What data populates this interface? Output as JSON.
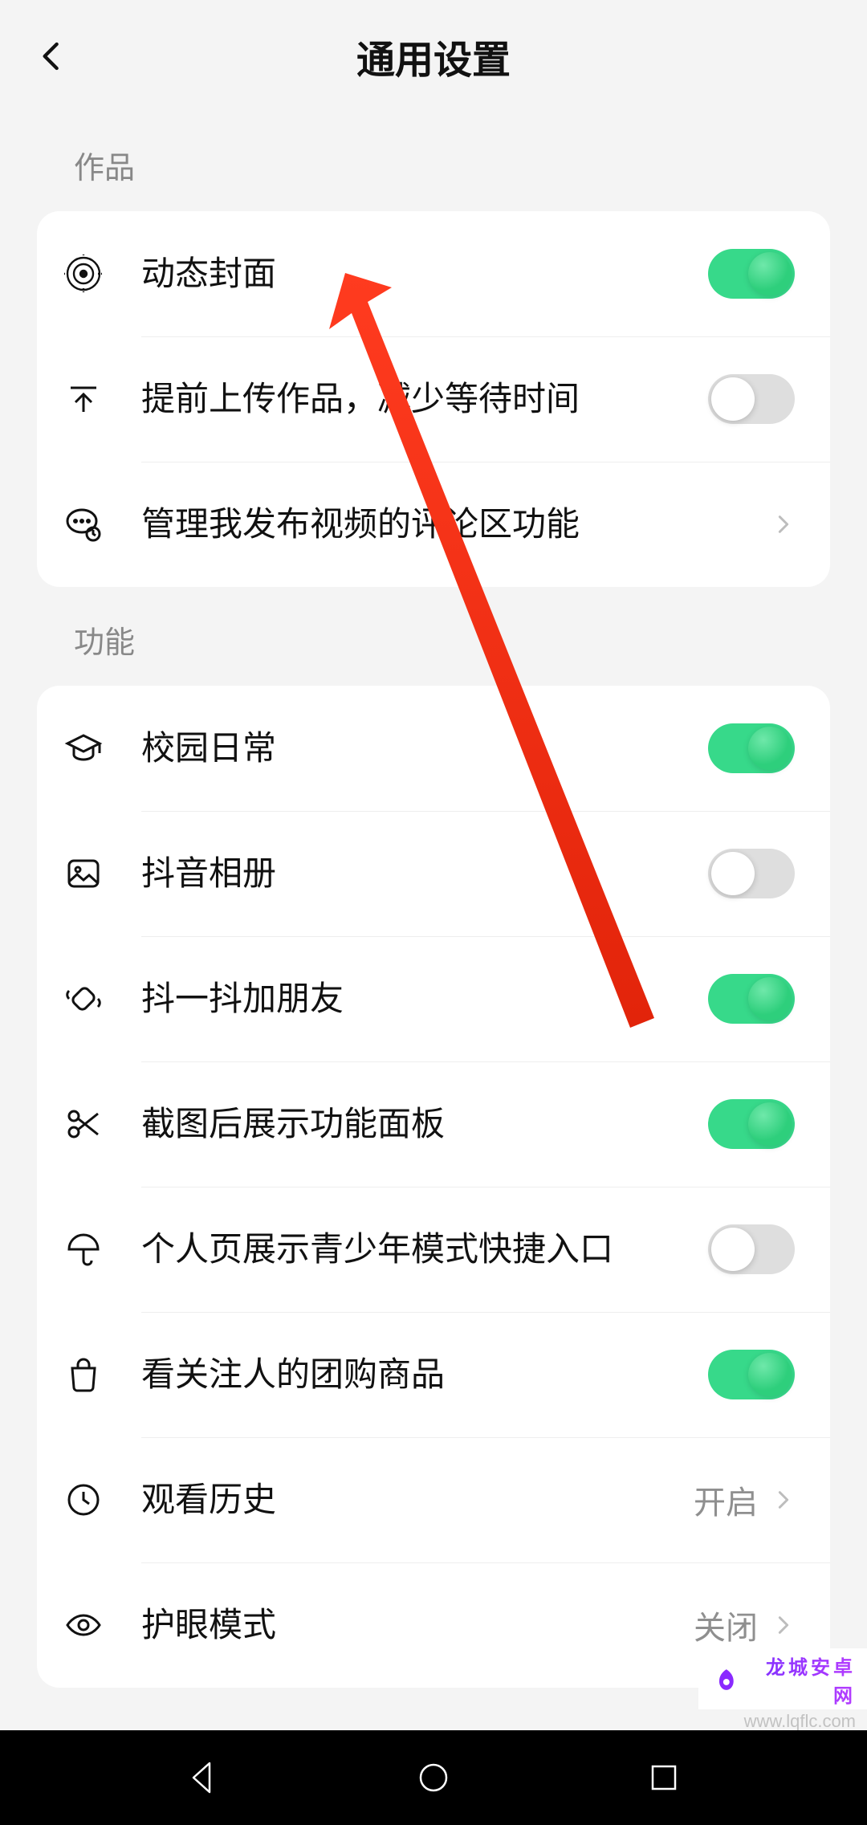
{
  "header": {
    "title": "通用设置"
  },
  "sections": [
    {
      "header": "作品",
      "rows": [
        {
          "icon": "target",
          "label": "动态封面",
          "kind": "toggle",
          "on": true
        },
        {
          "icon": "upload",
          "label": "提前上传作品，减少等待时间",
          "kind": "toggle",
          "on": false
        },
        {
          "icon": "comment",
          "label": "管理我发布视频的评论区功能",
          "kind": "nav"
        }
      ]
    },
    {
      "header": "功能",
      "rows": [
        {
          "icon": "grad",
          "label": "校园日常",
          "kind": "toggle",
          "on": true
        },
        {
          "icon": "image",
          "label": "抖音相册",
          "kind": "toggle",
          "on": false
        },
        {
          "icon": "shake",
          "label": "抖一抖加朋友",
          "kind": "toggle",
          "on": true
        },
        {
          "icon": "scissors",
          "label": "截图后展示功能面板",
          "kind": "toggle",
          "on": true
        },
        {
          "icon": "umbrella",
          "label": "个人页展示青少年模式快捷入口",
          "kind": "toggle",
          "on": false
        },
        {
          "icon": "bag",
          "label": "看关注人的团购商品",
          "kind": "toggle",
          "on": true
        },
        {
          "icon": "clock",
          "label": "观看历史",
          "kind": "nav",
          "value": "开启"
        },
        {
          "icon": "eye",
          "label": "护眼模式",
          "kind": "nav",
          "value": "关闭"
        }
      ]
    }
  ],
  "watermark": {
    "brand": "龙城安卓网",
    "url": "www.lqflc.com"
  }
}
